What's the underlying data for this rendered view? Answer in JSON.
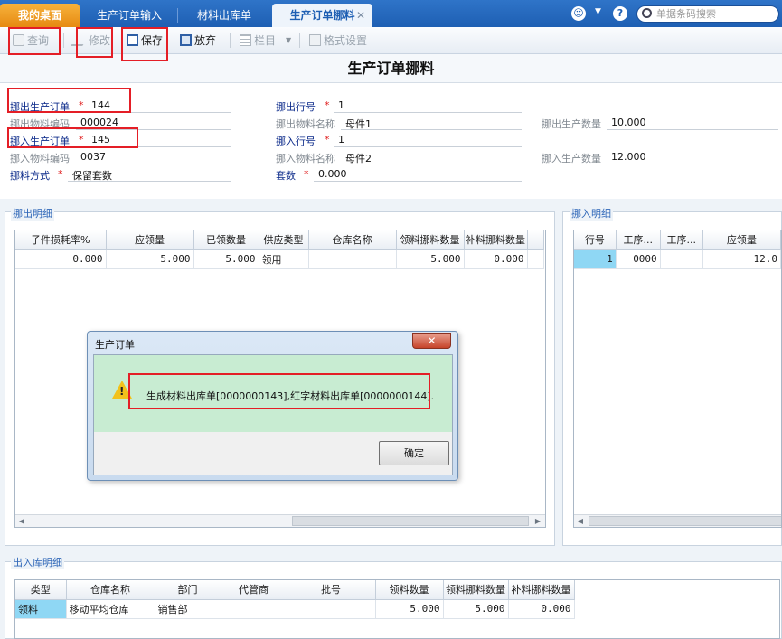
{
  "tabs": [
    {
      "label": "我的桌面"
    },
    {
      "label": "生产订单输入"
    },
    {
      "label": "材料出库单"
    },
    {
      "label": "生产订单挪料"
    }
  ],
  "search": {
    "placeholder": "单据条码搜索"
  },
  "toolbar": {
    "query": "查询",
    "edit": "修改",
    "save": "保存",
    "discard": "放弃",
    "columns": "栏目",
    "format": "格式设置"
  },
  "page_title": "生产订单挪料",
  "form": {
    "out_order_label": "挪出生产订单",
    "out_order_value": "144",
    "out_line_label": "挪出行号",
    "out_line_value": "1",
    "out_mat_code_label": "挪出物料编码",
    "out_mat_code_value": "000024",
    "out_mat_name_label": "挪出物料名称",
    "out_mat_name_value": "母件1",
    "out_qty_label": "挪出生产数量",
    "out_qty_value": "10.000",
    "in_order_label": "挪入生产订单",
    "in_order_value": "145",
    "in_line_label": "挪入行号",
    "in_line_value": "1",
    "in_mat_code_label": "挪入物料编码",
    "in_mat_code_value": "0037",
    "in_mat_name_label": "挪入物料名称",
    "in_mat_name_value": "母件2",
    "in_qty_label": "挪入生产数量",
    "in_qty_value": "12.000",
    "method_label": "挪料方式",
    "method_value": "保留套数",
    "sets_label": "套数",
    "sets_value": "0.000"
  },
  "out_detail": {
    "title": "挪出明细",
    "headers": [
      "子件损耗率%",
      "应领量",
      "已领数量",
      "供应类型",
      "仓库名称",
      "领料挪料数量",
      "补料挪料数量"
    ],
    "rows": [
      [
        "0.000",
        "5.000",
        "5.000",
        "领用",
        "",
        "5.000",
        "0.000"
      ]
    ]
  },
  "in_detail": {
    "title": "挪入明细",
    "headers": [
      "行号",
      "工序...",
      "工序...",
      "应领量"
    ],
    "rows": [
      [
        "1",
        "0000",
        "",
        "12.0"
      ]
    ]
  },
  "io_detail": {
    "title": "出入库明细",
    "headers": [
      "类型",
      "仓库名称",
      "部门",
      "代管商",
      "批号",
      "领料数量",
      "领料挪料数量",
      "补料挪料数量"
    ],
    "rows": [
      [
        "领料",
        "移动平均仓库",
        "销售部",
        "",
        "",
        "5.000",
        "5.000",
        "0.000"
      ]
    ]
  },
  "dialog": {
    "title": "生产订单",
    "message": "生成材料出库单[0000000143],红字材料出库单[0000000144].",
    "ok": "确定",
    "close": "✕"
  },
  "colors": {
    "accent": "#1e5fb3",
    "home_tab": "#f0a22a",
    "highlight_box": "#e41e26",
    "selected_cell": "#8fd7f4"
  }
}
